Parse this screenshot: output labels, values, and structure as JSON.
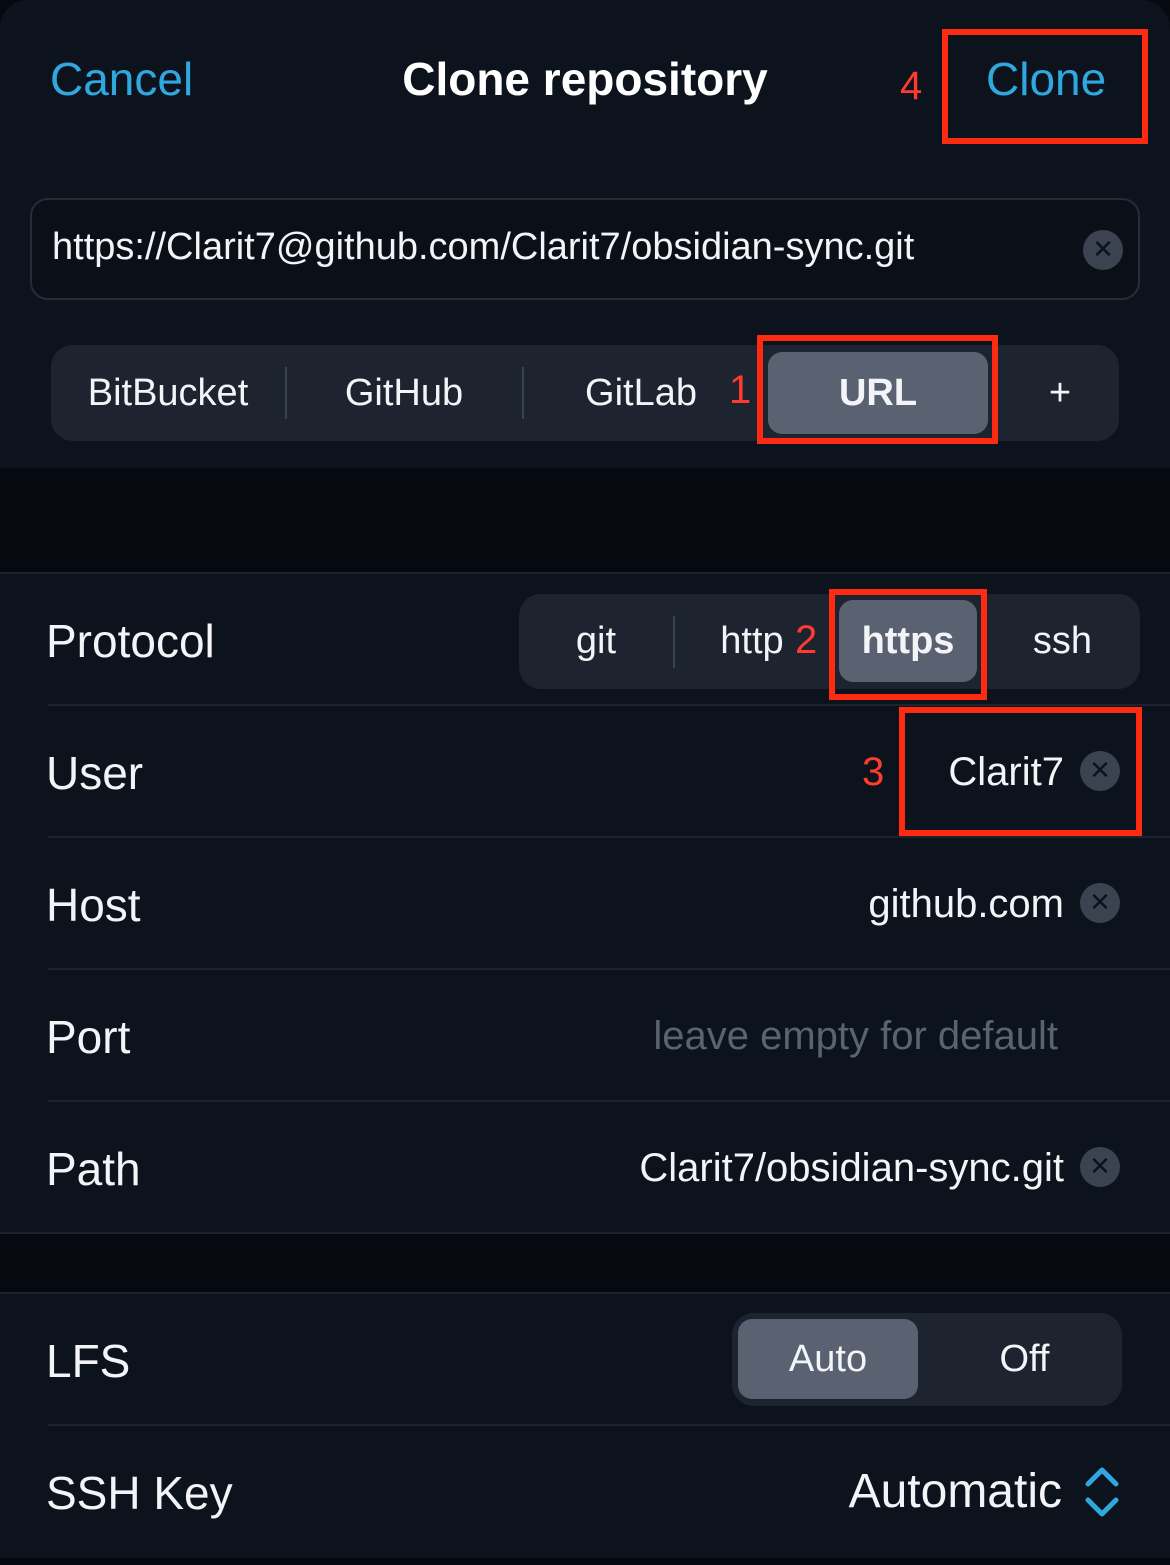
{
  "nav": {
    "cancel_label": "Cancel",
    "title": "Clone repository",
    "clone_label": "Clone"
  },
  "url_field": {
    "value": "https://Clarit7@github.com/Clarit7/obsidian-sync.git"
  },
  "source_tabs": {
    "items": [
      {
        "label": "BitBucket"
      },
      {
        "label": "GitHub"
      },
      {
        "label": "GitLab"
      },
      {
        "label": "URL"
      },
      {
        "label": "+"
      }
    ],
    "selected": "URL"
  },
  "form": {
    "protocol": {
      "label": "Protocol",
      "options": [
        "git",
        "http",
        "https",
        "ssh"
      ],
      "selected": "https"
    },
    "user": {
      "label": "User",
      "value": "Clarit7"
    },
    "host": {
      "label": "Host",
      "value": "github.com"
    },
    "port": {
      "label": "Port",
      "placeholder": "leave empty for default"
    },
    "path": {
      "label": "Path",
      "value": "Clarit7/obsidian-sync.git"
    }
  },
  "options": {
    "lfs": {
      "label": "LFS",
      "options": [
        "Auto",
        "Off"
      ],
      "selected": "Auto"
    },
    "ssh_key": {
      "label": "SSH Key",
      "value": "Automatic"
    }
  },
  "annotations": {
    "step1": "1",
    "step2": "2",
    "step3": "3",
    "step4": "4"
  },
  "colors": {
    "accent": "#2fa8e0",
    "annotation": "#ff2a12",
    "background": "#06090f",
    "panel": "#0d131c"
  },
  "icons": {
    "clear": "clear-circle-icon",
    "ssh_key_picker": "chevron-up-down-icon"
  }
}
